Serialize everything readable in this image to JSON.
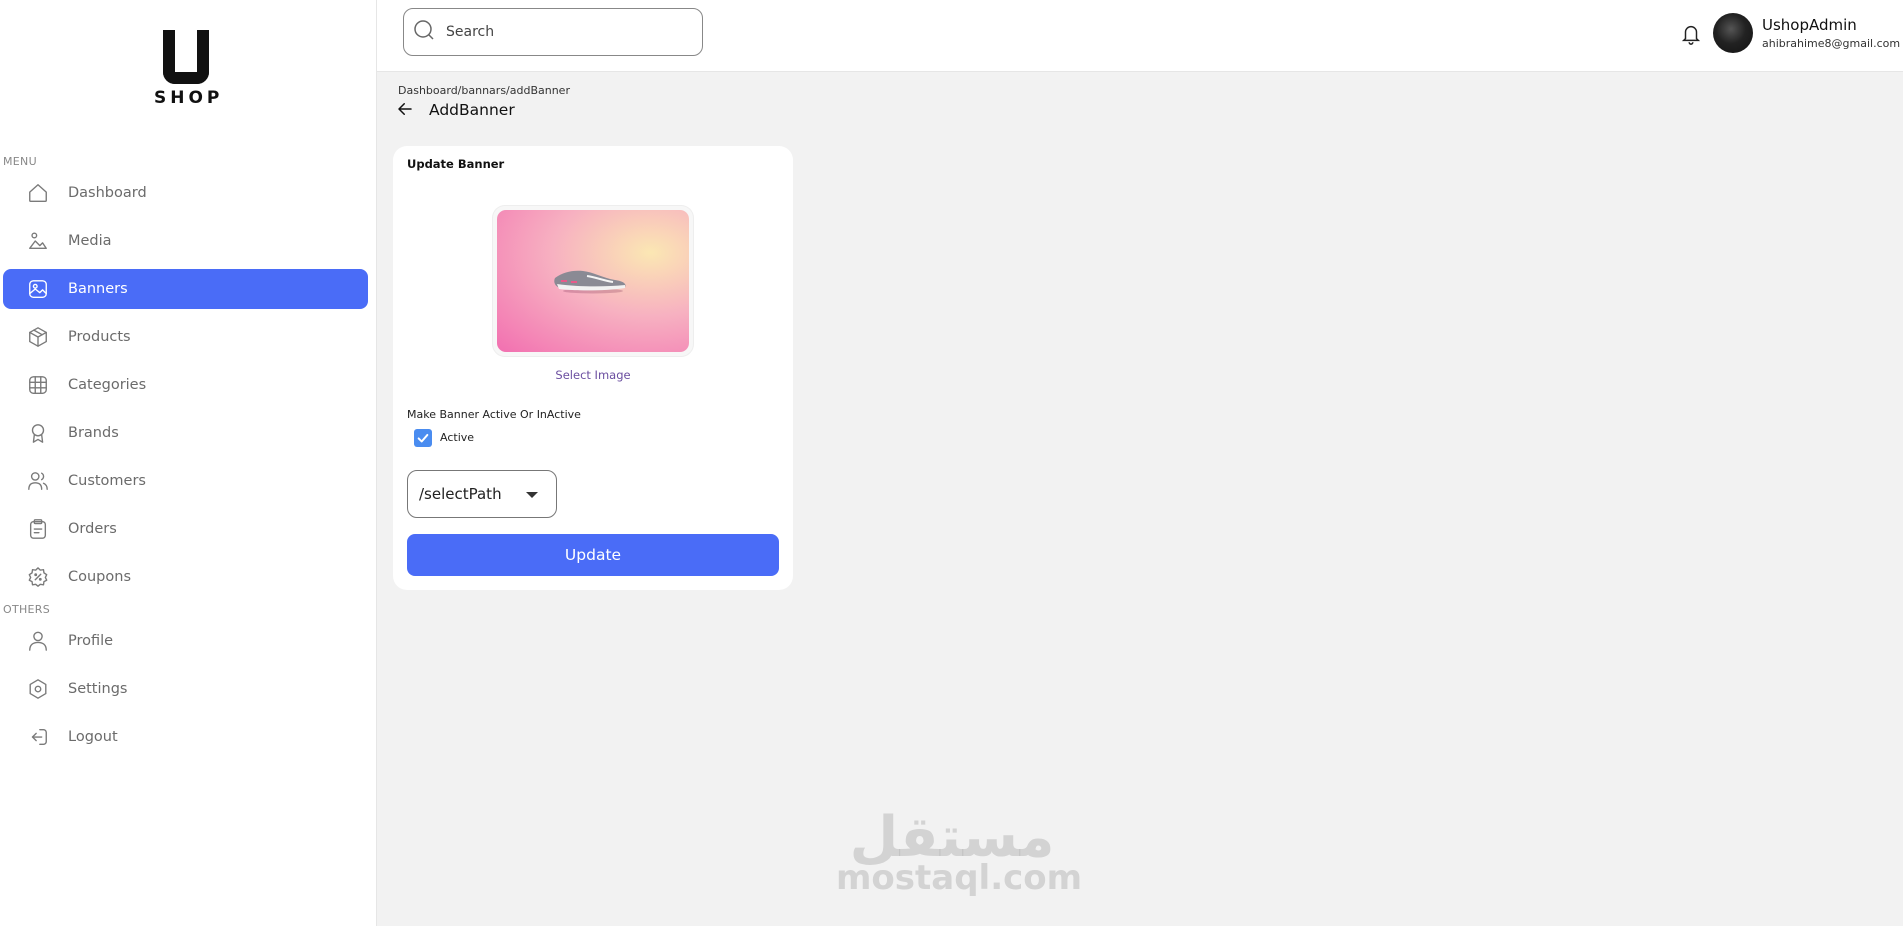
{
  "brand": {
    "logo_text": "SHOP"
  },
  "sidebar": {
    "menu_label": "MENU",
    "others_label": "OTHERS",
    "items": [
      {
        "label": "Dashboard",
        "icon": "home-icon"
      },
      {
        "label": "Media",
        "icon": "media-icon"
      },
      {
        "label": "Banners",
        "icon": "image-icon",
        "active": true
      },
      {
        "label": "Products",
        "icon": "box-icon"
      },
      {
        "label": "Categories",
        "icon": "grid-icon"
      },
      {
        "label": "Brands",
        "icon": "award-icon"
      },
      {
        "label": "Customers",
        "icon": "users-icon"
      },
      {
        "label": "Orders",
        "icon": "clipboard-icon"
      },
      {
        "label": "Coupons",
        "icon": "discount-icon"
      }
    ],
    "others": [
      {
        "label": "Profile",
        "icon": "user-icon"
      },
      {
        "label": "Settings",
        "icon": "gear-icon"
      },
      {
        "label": "Logout",
        "icon": "logout-icon"
      }
    ]
  },
  "topbar": {
    "search_placeholder": "Search",
    "user_name": "UshopAdmin",
    "user_email": "ahibrahime8@gmail.com"
  },
  "page": {
    "breadcrumb": "Dashboard/bannars/addBanner",
    "title": "AddBanner"
  },
  "card": {
    "title": "Update Banner",
    "select_image": "Select Image",
    "active_label": "Make Banner Active Or InActive",
    "checkbox_label": "Active",
    "checkbox_checked": true,
    "path_value": "/selectPath",
    "update_button": "Update"
  },
  "colors": {
    "accent": "#4a6cf7",
    "checkbox": "#4a8cf0",
    "link": "#6b4ea0"
  },
  "watermark": {
    "arabic": "مستقل",
    "site": "mostaql.com"
  }
}
